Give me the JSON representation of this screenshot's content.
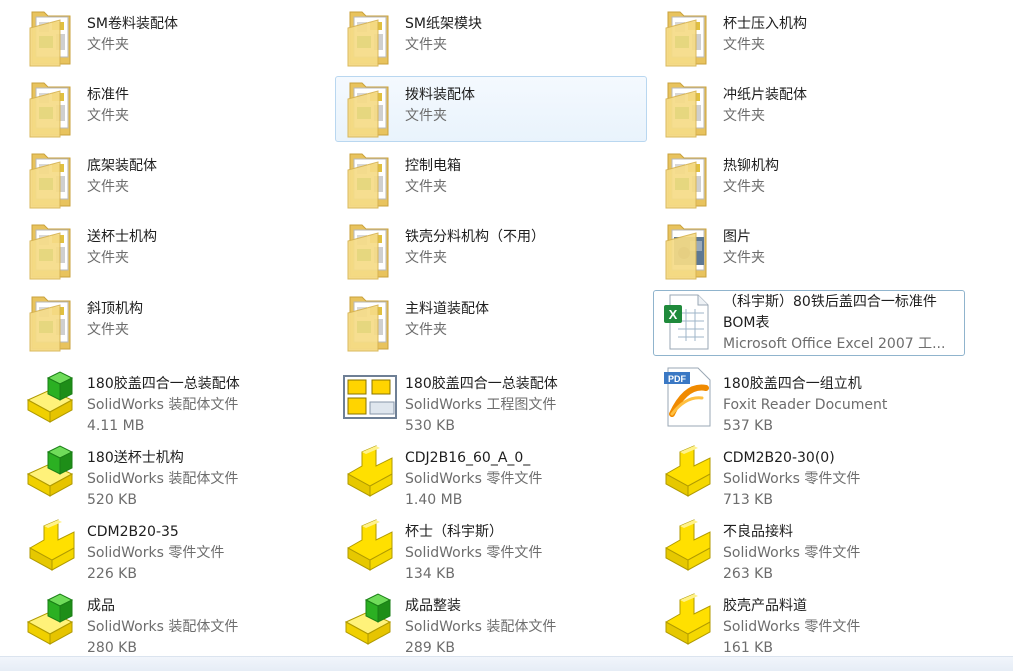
{
  "items": [
    {
      "name": "SM卷料装配体",
      "type": "文件夹",
      "icon": "folder-icon"
    },
    {
      "name": "SM纸架模块",
      "type": "文件夹",
      "icon": "folder-icon"
    },
    {
      "name": "杯士压入机构",
      "type": "文件夹",
      "icon": "folder-icon"
    },
    {
      "name": "标准件",
      "type": "文件夹",
      "icon": "folder-icon"
    },
    {
      "name": "拨料装配体",
      "type": "文件夹",
      "icon": "folder-icon"
    },
    {
      "name": "冲纸片装配体",
      "type": "文件夹",
      "icon": "folder-icon"
    },
    {
      "name": "底架装配体",
      "type": "文件夹",
      "icon": "folder-icon"
    },
    {
      "name": "控制电箱",
      "type": "文件夹",
      "icon": "folder-icon"
    },
    {
      "name": "热铆机构",
      "type": "文件夹",
      "icon": "folder-icon"
    },
    {
      "name": "送杯士机构",
      "type": "文件夹",
      "icon": "folder-icon"
    },
    {
      "name": "铁壳分料机构（不用）",
      "type": "文件夹",
      "icon": "folder-icon"
    },
    {
      "name": "图片",
      "type": "文件夹",
      "icon": "picture-folder-icon"
    },
    {
      "name": "斜顶机构",
      "type": "文件夹",
      "icon": "folder-icon"
    },
    {
      "name": "主料道装配体",
      "type": "文件夹",
      "icon": "folder-icon"
    },
    {
      "name": "（科宇斯）80铁后盖四合一标准件BOM表",
      "type": "Microsoft Office Excel 2007 工...",
      "icon": "excel-file-icon"
    },
    {
      "name": "180胶盖四合一总装配体",
      "type": "SolidWorks 装配体文件",
      "size": "4.11 MB",
      "icon": "solidworks-assembly-icon"
    },
    {
      "name": "180胶盖四合一总装配体",
      "type": "SolidWorks 工程图文件",
      "size": "530 KB",
      "icon": "solidworks-drawing-icon"
    },
    {
      "name": "180胶盖四合一组立机",
      "type": "Foxit Reader Document",
      "size": "537 KB",
      "icon": "pdf-file-icon"
    },
    {
      "name": "180送杯士机构",
      "type": "SolidWorks 装配体文件",
      "size": "520 KB",
      "icon": "solidworks-assembly-icon"
    },
    {
      "name": "CDJ2B16_60_A_0_",
      "type": "SolidWorks 零件文件",
      "size": "1.40 MB",
      "icon": "solidworks-part-icon"
    },
    {
      "name": "CDM2B20-30(0)",
      "type": "SolidWorks 零件文件",
      "size": "713 KB",
      "icon": "solidworks-part-icon"
    },
    {
      "name": "CDM2B20-35",
      "type": "SolidWorks 零件文件",
      "size": "226 KB",
      "icon": "solidworks-part-icon"
    },
    {
      "name": "杯士（科宇斯）",
      "type": "SolidWorks 零件文件",
      "size": "134 KB",
      "icon": "solidworks-part-icon"
    },
    {
      "name": "不良品接料",
      "type": "SolidWorks 零件文件",
      "size": "263 KB",
      "icon": "solidworks-part-icon"
    },
    {
      "name": "成品",
      "type": "SolidWorks 装配体文件",
      "size": "280 KB",
      "icon": "solidworks-assembly-icon"
    },
    {
      "name": "成品整装",
      "type": "SolidWorks 装配体文件",
      "size": "289 KB",
      "icon": "solidworks-assembly-icon"
    },
    {
      "name": "胶壳产品料道",
      "type": "SolidWorks 零件文件",
      "size": "161 KB",
      "icon": "solidworks-part-icon"
    }
  ],
  "selected_index": 4,
  "focused_index": 14,
  "colors": {
    "folder": "#f3d37a",
    "assembly_green": "#22a61b",
    "part_yellow": "#ffe000",
    "selection_border": "#b9d7f0"
  }
}
